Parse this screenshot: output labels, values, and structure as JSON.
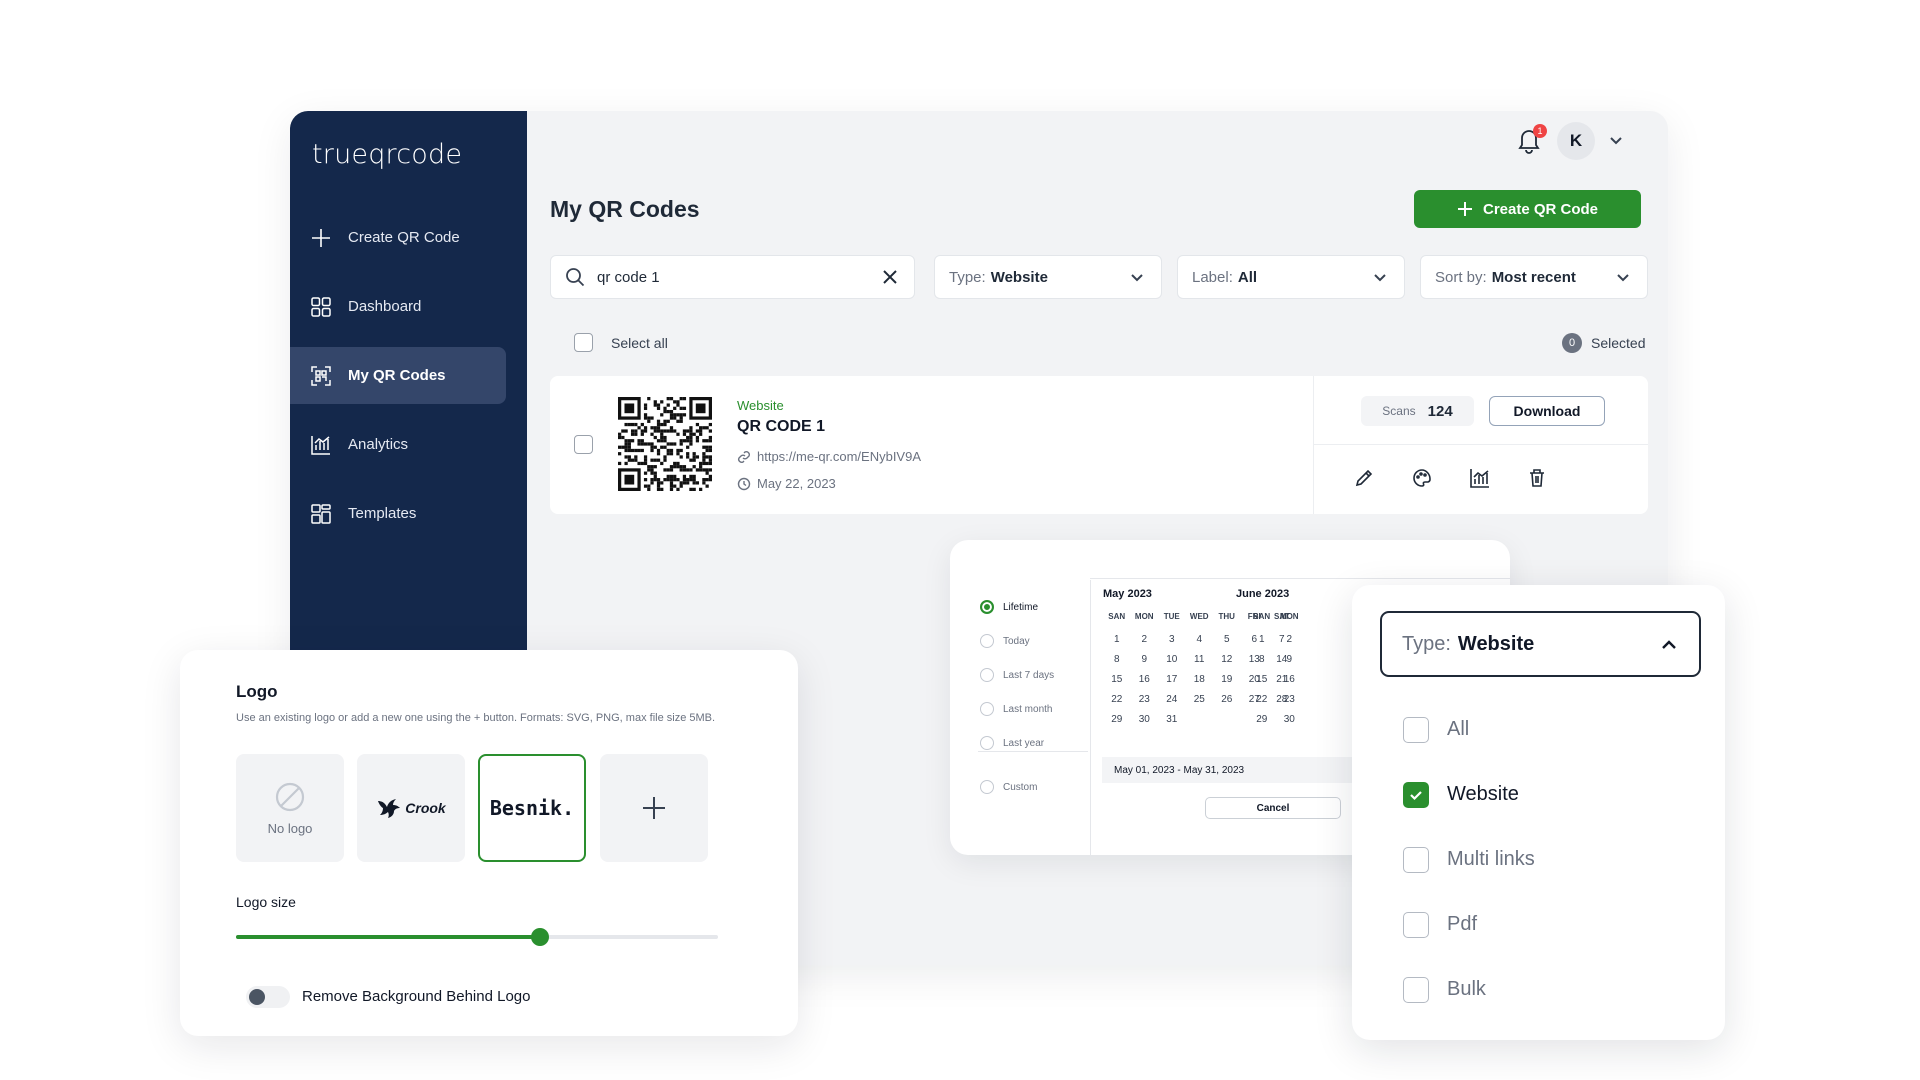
{
  "brand": {
    "name": "trueqrcode"
  },
  "sidebar": {
    "items": [
      {
        "label": "Create QR Code",
        "icon": "plus-icon"
      },
      {
        "label": "Dashboard",
        "icon": "grid-icon"
      },
      {
        "label": "My QR Codes",
        "icon": "qr-icon",
        "active": true
      },
      {
        "label": "Analytics",
        "icon": "chart-icon"
      },
      {
        "label": "Templates",
        "icon": "template-icon"
      }
    ]
  },
  "header": {
    "notification_count": "1",
    "avatar_initial": "K"
  },
  "main": {
    "title": "My QR Codes",
    "create_button": "Create QR Code",
    "search_value": "qr code 1",
    "filters": {
      "type_label": "Type:",
      "type_value": "Website",
      "label_label": "Label:",
      "label_value": "All",
      "sort_label": "Sort by:",
      "sort_value": "Most recent"
    },
    "select_all": "Select all",
    "selected_count": "0",
    "selected_label": "Selected"
  },
  "qr_item": {
    "type": "Website",
    "name": "QR CODE 1",
    "url": "https://me-qr.com/ENybIV9A",
    "date": "May 22, 2023",
    "scans_label": "Scans",
    "scans_value": "124",
    "download_label": "Download"
  },
  "date_range": {
    "options": [
      "Lifetime",
      "Today",
      "Last 7 days",
      "Last month",
      "Last year"
    ],
    "custom": "Custom",
    "selected": "Lifetime",
    "month1": {
      "title": "May 2023",
      "dow": [
        "SAN",
        "MON",
        "TUE",
        "WED",
        "THU",
        "FRI",
        "SAT"
      ],
      "days": [
        "1",
        "2",
        "3",
        "4",
        "5",
        "6",
        "7",
        "8",
        "9",
        "10",
        "11",
        "12",
        "13",
        "14",
        "15",
        "16",
        "17",
        "18",
        "19",
        "20",
        "21",
        "22",
        "23",
        "24",
        "25",
        "26",
        "27",
        "28",
        "29",
        "30",
        "31"
      ]
    },
    "month2": {
      "title": "June 2023",
      "dow": [
        "SAN",
        "MON"
      ],
      "days": [
        "1",
        "2",
        "8",
        "9",
        "15",
        "16",
        "22",
        "23",
        "29",
        "30"
      ]
    },
    "range_text": "May 01, 2023 - May 31, 2023",
    "cancel": "Cancel"
  },
  "type_dropdown": {
    "label": "Type:",
    "value": "Website",
    "options": [
      {
        "label": "All",
        "checked": false
      },
      {
        "label": "Website",
        "checked": true
      },
      {
        "label": "Multi links",
        "checked": false
      },
      {
        "label": "Pdf",
        "checked": false
      },
      {
        "label": "Bulk",
        "checked": false
      }
    ]
  },
  "logo_panel": {
    "title": "Logo",
    "description": "Use an existing logo or add a new one using the + button. Formats: SVG, PNG, max file size 5MB.",
    "tiles": {
      "no_logo": "No logo",
      "crook": "Crook",
      "besnik": "Besnik."
    },
    "size_label": "Logo size",
    "size_percent": 63,
    "remove_bg_label": "Remove Background Behind Logo",
    "remove_bg_on": false
  },
  "colors": {
    "accent": "#2a8f2e",
    "sidebar": "#14284b",
    "sidebar_active": "#34466a",
    "badge": "#ef4444"
  }
}
